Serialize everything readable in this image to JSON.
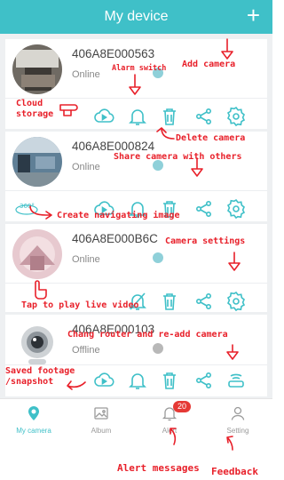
{
  "header": {
    "title": "My device",
    "add_symbol": "+"
  },
  "cameras": [
    {
      "id": "406A8E000563",
      "status": "Online"
    },
    {
      "id": "406A8E000824",
      "status": "Online"
    },
    {
      "id": "406A8E000B6C",
      "status": "Online"
    },
    {
      "id": "406A8E000103",
      "status": "Offline"
    }
  ],
  "tabs": [
    {
      "label": "My camera",
      "icon": "camera-pin-icon",
      "active": true
    },
    {
      "label": "Album",
      "icon": "album-icon"
    },
    {
      "label": "Alert",
      "icon": "bell-icon",
      "badge": "20"
    },
    {
      "label": "Setting",
      "icon": "person-icon"
    }
  ],
  "annotations": {
    "add_camera": "Add camera",
    "alarm_switch": "Alarm switch",
    "cloud_storage": "Cloud\nstorage",
    "delete_camera": "Delete camera",
    "share_camera": "Share camera with others",
    "create_navigating": "Create navigating image",
    "camera_settings": "Camera settings",
    "tap_live": "Tap to play live video",
    "change_router": "Chang router and re-add camera",
    "saved_footage": "Saved footage\n/snapshot",
    "alert_messages": "Alert messages",
    "feedback": "Feedback"
  },
  "colors": {
    "accent": "#3fc0c8",
    "annotation": "#e8202a",
    "badge": "#e53935",
    "background": "#eef0f2"
  }
}
